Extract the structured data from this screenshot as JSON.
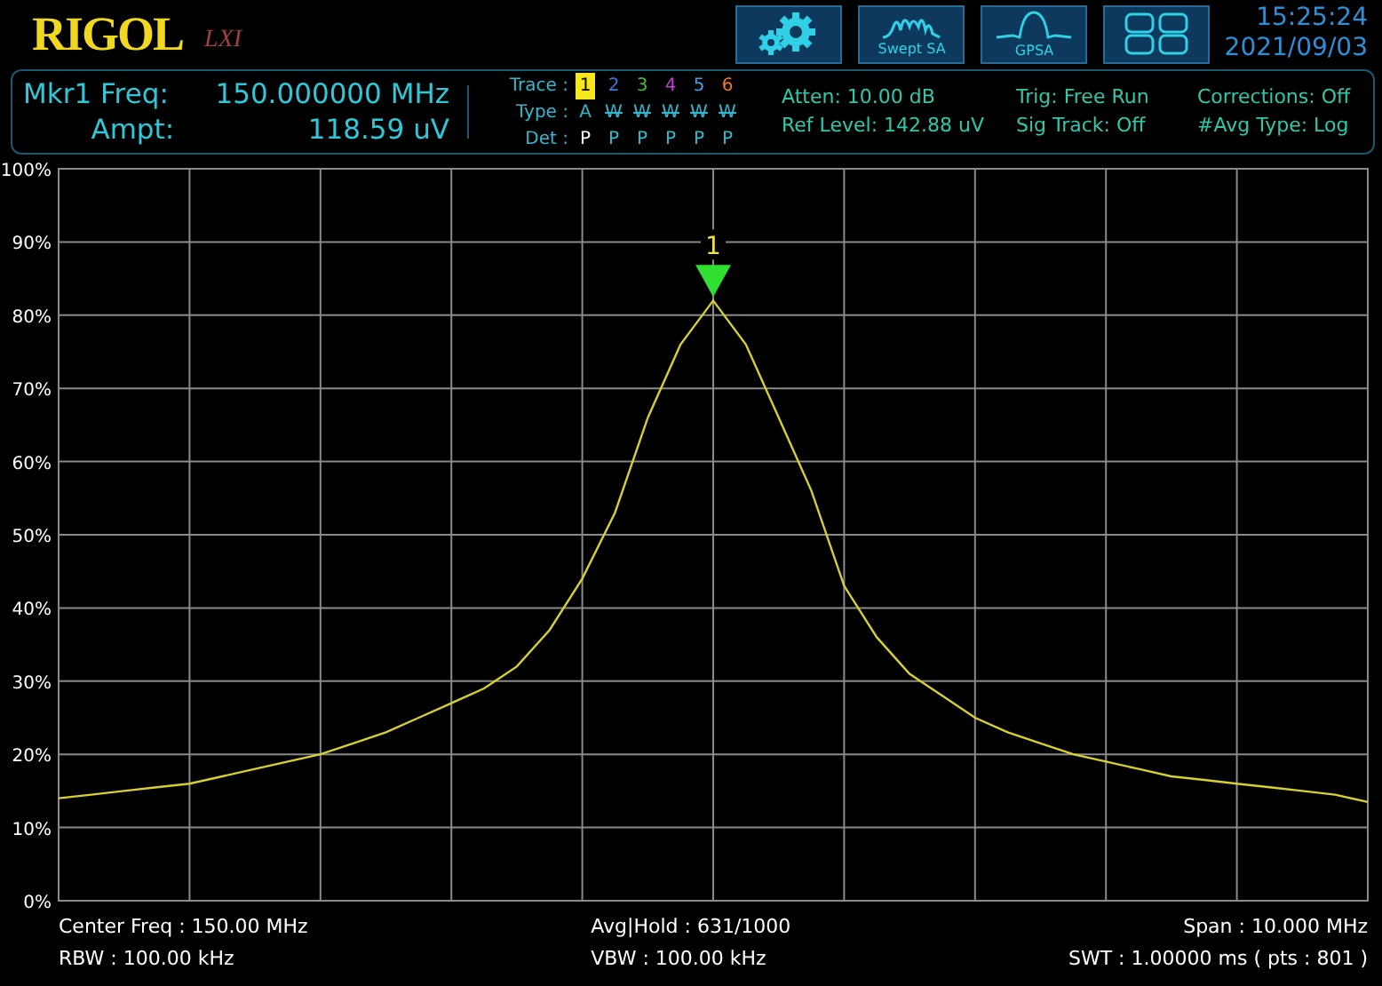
{
  "brand": {
    "logo": "RIGOL",
    "badge": "LXI"
  },
  "toolbar": [
    {
      "kind": "gear"
    },
    {
      "kind": "swept",
      "label": "Swept SA"
    },
    {
      "kind": "gpsa",
      "label": "GPSA"
    },
    {
      "kind": "layout"
    }
  ],
  "clock": {
    "time": "15:25:24",
    "date": "2021/09/03"
  },
  "marker_readout": {
    "freq_label": "Mkr1 Freq:",
    "freq_value": "150.000000 MHz",
    "ampt_label": "Ampt:",
    "ampt_value": "118.59 uV"
  },
  "traces": {
    "trace_label": "Trace :",
    "type_label": "Type :",
    "det_label": "Det :",
    "items": [
      {
        "label": "1",
        "color": "#f5e61e",
        "selected": true,
        "type": "A",
        "type_disabled": false,
        "det": "P"
      },
      {
        "label": "2",
        "color": "#3a78e0",
        "selected": false,
        "type": "W",
        "type_disabled": true,
        "det": "P"
      },
      {
        "label": "3",
        "color": "#3cc43c",
        "selected": false,
        "type": "W",
        "type_disabled": true,
        "det": "P"
      },
      {
        "label": "4",
        "color": "#c040d0",
        "selected": false,
        "type": "W",
        "type_disabled": true,
        "det": "P"
      },
      {
        "label": "5",
        "color": "#3fa0e8",
        "selected": false,
        "type": "W",
        "type_disabled": true,
        "det": "P"
      },
      {
        "label": "6",
        "color": "#f07830",
        "selected": false,
        "type": "W",
        "type_disabled": true,
        "det": "P"
      }
    ]
  },
  "settings": [
    "Atten: 10.00 dB",
    "Ref Level: 142.88 uV",
    "Trig: Free Run",
    "Sig Track: Off",
    "Corrections: Off",
    "#Avg Type: Log"
  ],
  "chart_data": {
    "type": "line",
    "categories": [
      null,
      null,
      null,
      null,
      null,
      null,
      null,
      null,
      null,
      null,
      null,
      null,
      null,
      null,
      null,
      null,
      null,
      null,
      null,
      null,
      null,
      null,
      null,
      null,
      null,
      null,
      null,
      null,
      null,
      null,
      null,
      null,
      null,
      null,
      null,
      null,
      null,
      null,
      null,
      null,
      null
    ],
    "ylim": [
      0,
      100
    ],
    "grid": true,
    "yticks": [
      {
        "value": 0,
        "label": "0%"
      },
      {
        "value": 10,
        "label": "10%"
      },
      {
        "value": 20,
        "label": "20%"
      },
      {
        "value": 30,
        "label": "30%"
      },
      {
        "value": 40,
        "label": "40%"
      },
      {
        "value": 50,
        "label": "50%"
      },
      {
        "value": 60,
        "label": "60%"
      },
      {
        "value": 70,
        "label": "70%"
      },
      {
        "value": 80,
        "label": "80%"
      },
      {
        "value": 90,
        "label": "90%"
      },
      {
        "value": 100,
        "label": "100%"
      }
    ],
    "series": [
      {
        "color": "#d8d030",
        "values": [
          14,
          14.5,
          15,
          15.5,
          16,
          17,
          18,
          19,
          20,
          21.5,
          23,
          25,
          27,
          29,
          32,
          37,
          44,
          53,
          66,
          76,
          82,
          76,
          66,
          56,
          43,
          36,
          31,
          28,
          25,
          23,
          21.5,
          20,
          19,
          18,
          17,
          16.5,
          16,
          15.5,
          15,
          14.5,
          13.5
        ]
      }
    ],
    "annotations": [
      {
        "text": "1"
      }
    ]
  },
  "footer": [
    "Center Freq : 150.00 MHz",
    "Avg|Hold : 631/1000",
    "Span : 10.000 MHz",
    "RBW : 100.00 kHz",
    "VBW : 100.00 kHz",
    "SWT : 1.00000 ms ( pts : 801 )"
  ]
}
